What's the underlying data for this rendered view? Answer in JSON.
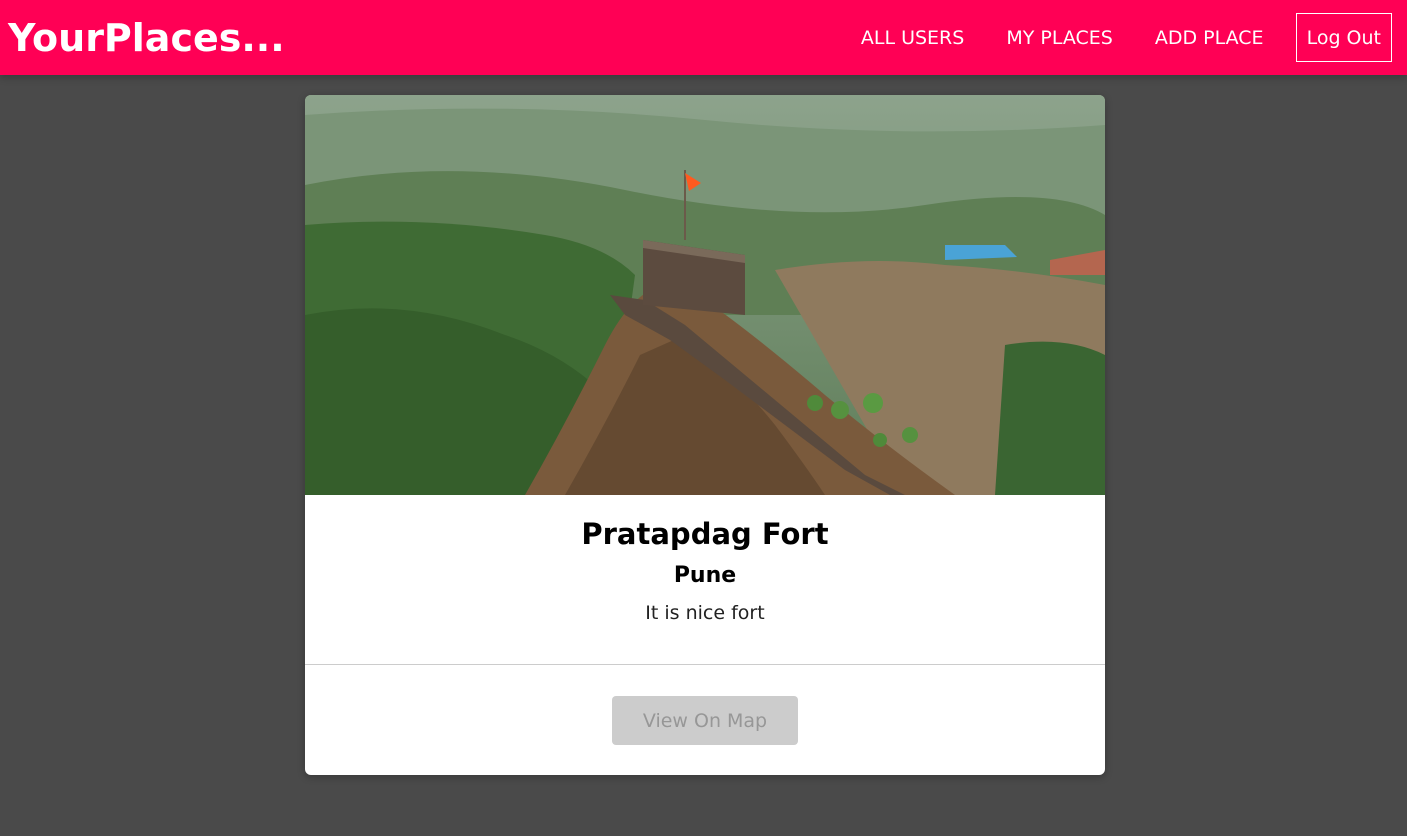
{
  "header": {
    "logo": "YourPlaces...",
    "nav": {
      "all_users": "ALL USERS",
      "my_places": "MY PLACES",
      "add_place": "ADD PLACE",
      "logout": "Log Out"
    }
  },
  "colors": {
    "brand": "#ff0055",
    "background": "#4a4a4a",
    "disabled_button": "#cccccc"
  },
  "place": {
    "title": "Pratapdag Fort",
    "address": "Pune",
    "description": "It is nice fort",
    "view_on_map": "View On Map"
  }
}
